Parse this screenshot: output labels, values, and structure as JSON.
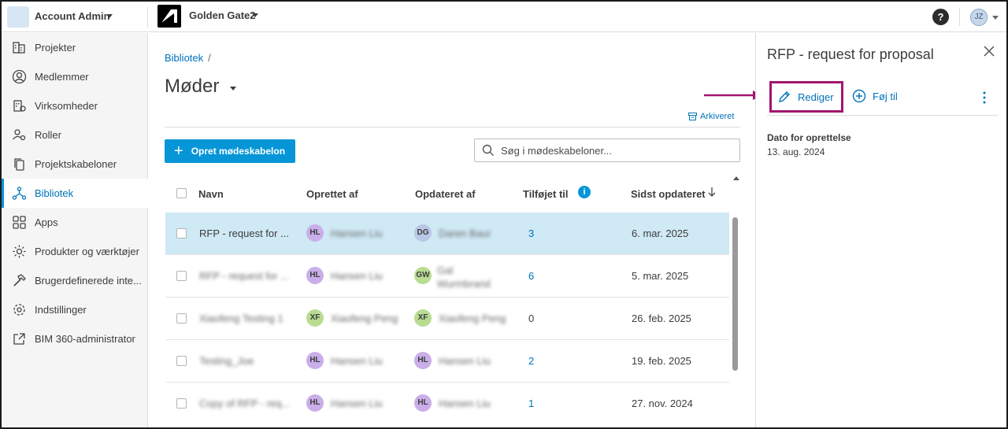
{
  "topbar": {
    "account_label": "Account Admin",
    "project_name": "Golden Gate2",
    "help_label": "?",
    "user_initials": "JZ"
  },
  "sidebar": {
    "items": [
      {
        "label": "Projekter",
        "icon": "building-icon"
      },
      {
        "label": "Medlemmer",
        "icon": "user-circle-icon"
      },
      {
        "label": "Virksomheder",
        "icon": "company-icon"
      },
      {
        "label": "Roller",
        "icon": "user-settings-icon"
      },
      {
        "label": "Projektskabeloner",
        "icon": "copy-icon"
      },
      {
        "label": "Bibliotek",
        "icon": "network-icon",
        "active": true
      },
      {
        "label": "Apps",
        "icon": "grid-icon"
      },
      {
        "label": "Produkter og værktøjer",
        "icon": "gear-icon"
      },
      {
        "label": "Brugerdefinerede inte...",
        "icon": "hammer-icon"
      },
      {
        "label": "Indstillinger",
        "icon": "settings-icon"
      },
      {
        "label": "BIM 360-administrator",
        "icon": "external-link-icon"
      }
    ]
  },
  "main": {
    "breadcrumb": "Bibliotek",
    "breadcrumb_sep": "/",
    "title": "Møder",
    "archive_label": "Arkiveret",
    "create_button": "Opret mødeskabelon",
    "search_placeholder": "Søg i mødeskabeloner...",
    "columns": [
      "Navn",
      "Oprettet af",
      "Opdateret af",
      "Tilføjet til",
      "Sidst opdateret"
    ],
    "rows": [
      {
        "name": "RFP - request for ...",
        "created_initials": "HL",
        "created_name": "Hansen Liu",
        "updated_initials": "DG",
        "updated_name": "Daren Baur",
        "added": "3",
        "date": "6. mar. 2025",
        "selected": true
      },
      {
        "name": "RFP - request for ...",
        "created_initials": "HL",
        "created_name": "Hansen Liu",
        "updated_initials": "GW",
        "updated_name": "Gal Wurmbrand",
        "added": "6",
        "date": "5. mar. 2025"
      },
      {
        "name": "Xiaofeng Testing 1",
        "created_initials": "XF",
        "created_name": "Xiaofeng Peng",
        "updated_initials": "XF",
        "updated_name": "Xiaofeng Peng",
        "added": "0",
        "date": "26. feb. 2025"
      },
      {
        "name": "Testing_Joe",
        "created_initials": "HL",
        "created_name": "Hansen Liu",
        "updated_initials": "HL",
        "updated_name": "Hansen Liu",
        "added": "2",
        "date": "19. feb. 2025"
      },
      {
        "name": "Copy of RFP - req...",
        "created_initials": "HL",
        "created_name": "Hansen Liu",
        "updated_initials": "HL",
        "updated_name": "Hansen Liu",
        "added": "1",
        "date": "27. nov. 2024"
      }
    ]
  },
  "panel": {
    "title": "RFP - request for proposal",
    "edit_label": "Rediger",
    "add_label": "Føj til",
    "created_label": "Dato for oprettelse",
    "created_value": "13. aug. 2024"
  },
  "colors": {
    "accent": "#0696d7",
    "link": "#0073b9",
    "highlight_border": "#a0166e",
    "selected_row": "#cfe9f5"
  }
}
